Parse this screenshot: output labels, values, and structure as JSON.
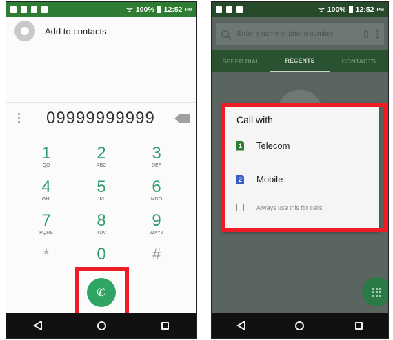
{
  "status_bar": {
    "signal": "100%",
    "time": "12:52",
    "ampm": "PM"
  },
  "left": {
    "add_to_contacts": "Add to contacts",
    "dialed_number": "09999999999",
    "keys": [
      {
        "digit": "1",
        "letters": "QO"
      },
      {
        "digit": "2",
        "letters": "ABC"
      },
      {
        "digit": "3",
        "letters": "DEF"
      },
      {
        "digit": "4",
        "letters": "GHI"
      },
      {
        "digit": "5",
        "letters": "JKL"
      },
      {
        "digit": "6",
        "letters": "MNO"
      },
      {
        "digit": "7",
        "letters": "PQRS"
      },
      {
        "digit": "8",
        "letters": "TUV"
      },
      {
        "digit": "9",
        "letters": "WXYZ"
      },
      {
        "digit": "*",
        "letters": ""
      },
      {
        "digit": "0",
        "letters": ""
      },
      {
        "digit": "#",
        "letters": ""
      }
    ]
  },
  "right": {
    "search_placeholder": "Enter a name or phone number",
    "tabs": [
      "SPEED DIAL",
      "RECENTS",
      "CONTACTS"
    ],
    "dialog": {
      "title": "Call with",
      "options": [
        {
          "sim": "1",
          "label": "Telecom",
          "color": "#2e7d32"
        },
        {
          "sim": "2",
          "label": "Mobile",
          "color": "#3b5fc0"
        }
      ],
      "always_label": "Always use this for calls"
    }
  },
  "colors": {
    "highlight": "#ee1c24",
    "accent": "#2e9c6a"
  }
}
